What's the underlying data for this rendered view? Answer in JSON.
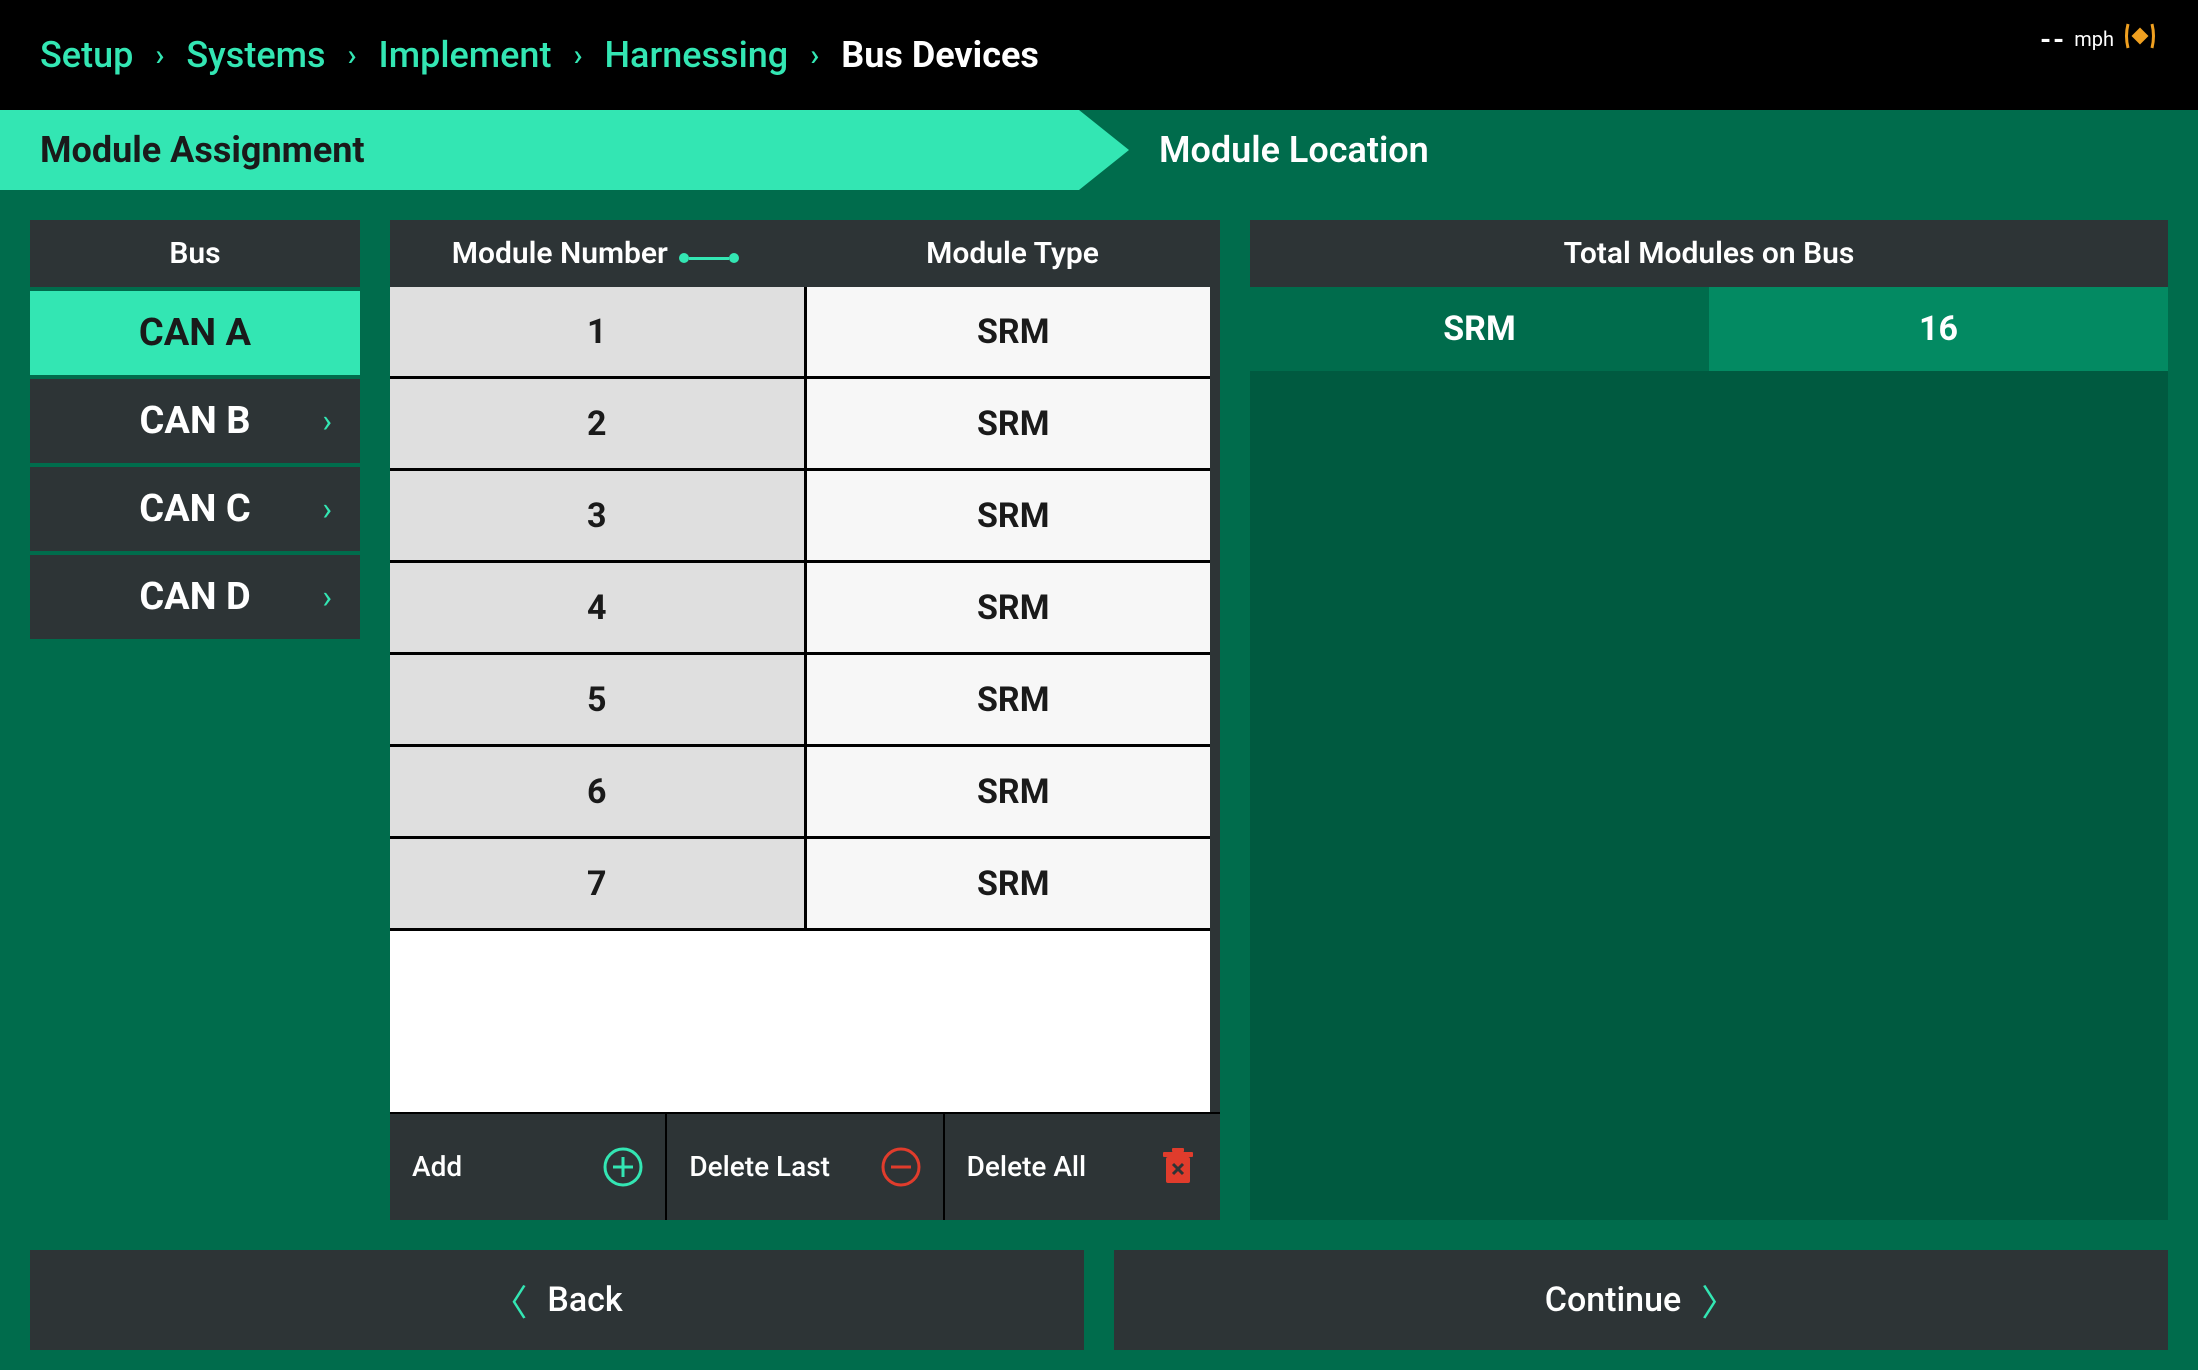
{
  "breadcrumb": {
    "items": [
      "Setup",
      "Systems",
      "Implement",
      "Harnessing",
      "Bus Devices"
    ],
    "current_index": 4
  },
  "status": {
    "speed_value": "--",
    "speed_unit": "mph"
  },
  "tabs": {
    "items": [
      {
        "label": "Module Assignment",
        "active": true
      },
      {
        "label": "Module Location",
        "active": false
      }
    ]
  },
  "bus": {
    "header": "Bus",
    "items": [
      {
        "label": "CAN A",
        "active": true
      },
      {
        "label": "CAN B",
        "active": false
      },
      {
        "label": "CAN C",
        "active": false
      },
      {
        "label": "CAN D",
        "active": false
      }
    ]
  },
  "modules": {
    "col_number": "Module Number",
    "col_type": "Module Type",
    "rows": [
      {
        "number": "1",
        "type": "SRM"
      },
      {
        "number": "2",
        "type": "SRM"
      },
      {
        "number": "3",
        "type": "SRM"
      },
      {
        "number": "4",
        "type": "SRM"
      },
      {
        "number": "5",
        "type": "SRM"
      },
      {
        "number": "6",
        "type": "SRM"
      },
      {
        "number": "7",
        "type": "SRM"
      }
    ],
    "actions": {
      "add": "Add",
      "delete_last": "Delete Last",
      "delete_all": "Delete All"
    }
  },
  "totals": {
    "header": "Total Modules on Bus",
    "rows": [
      {
        "type": "SRM",
        "count": "16"
      }
    ]
  },
  "footer": {
    "back": "Back",
    "continue": "Continue"
  }
}
